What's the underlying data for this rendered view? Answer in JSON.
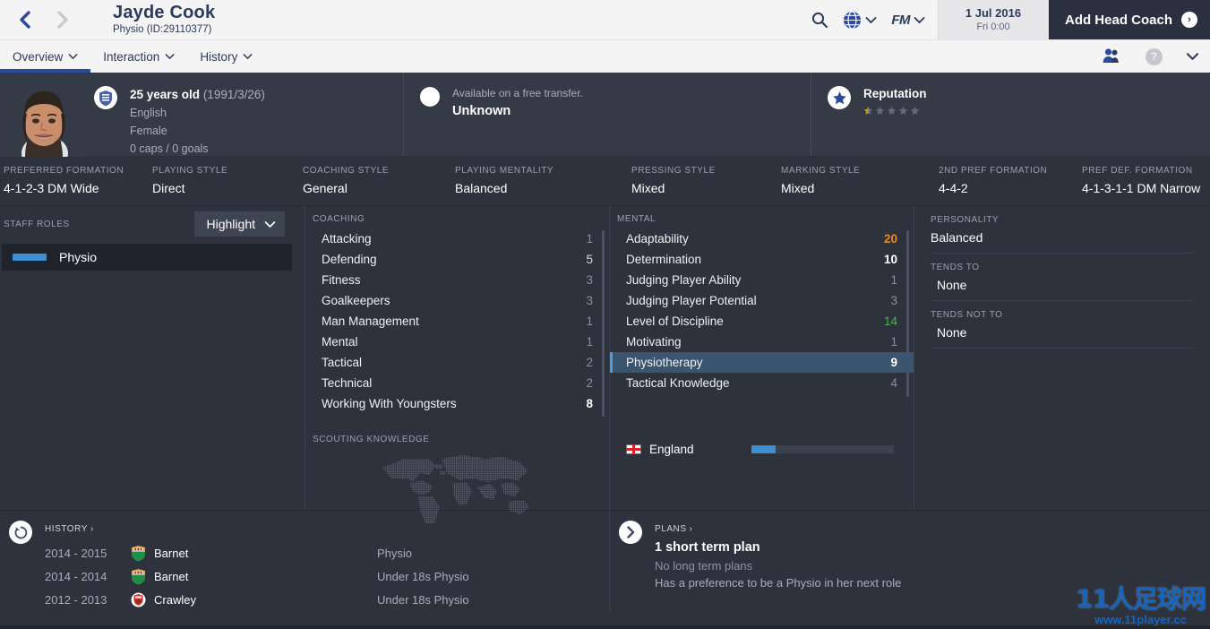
{
  "topbar": {
    "back_icon": "chevron-left-icon",
    "forward_icon": "chevron-right-icon",
    "person_name": "Jayde Cook",
    "person_subtitle": "Physio (ID:29110377)",
    "search_icon": "search-icon",
    "globe_icon": "globe-icon",
    "fm_logo": "FM",
    "date_main": "1 Jul 2016",
    "date_sub": "Fri 0:00",
    "add_coach_label": "Add Head Coach",
    "accent_blue": "#2c4a9c",
    "dark_panel": "#2b3040"
  },
  "subnav": {
    "items": [
      {
        "label": "Overview",
        "active": true
      },
      {
        "label": "Interaction",
        "active": false
      },
      {
        "label": "History",
        "active": false
      }
    ],
    "staff_icon": "people-icon",
    "help_label": "?",
    "more_icon": "chevron-down-icon"
  },
  "profile": {
    "photo_alt": "staff-portrait",
    "club_badge_icon": "club-badge-icon",
    "age_line_bold": "25 years old",
    "age_line_dim": "(1991/3/26)",
    "nationality": "English",
    "gender": "Female",
    "caps_goals": "0 caps / 0 goals",
    "transfer_status_label": "Available on a free transfer.",
    "transfer_value": "Unknown",
    "reputation_label": "Reputation",
    "reputation_stars": 0.5,
    "reputation_star_total": 5,
    "star_gold": "#c9a227",
    "star_grey": "#636a78"
  },
  "attributes_bar": [
    {
      "label": "PREFERRED FORMATION",
      "value": "4-1-2-3 DM Wide"
    },
    {
      "label": "PLAYING STYLE",
      "value": "Direct"
    },
    {
      "label": "COACHING STYLE",
      "value": "General"
    },
    {
      "label": "PLAYING MENTALITY",
      "value": "Balanced"
    },
    {
      "label": "PRESSING STYLE",
      "value": "Mixed"
    },
    {
      "label": "MARKING STYLE",
      "value": "Mixed"
    },
    {
      "label": "2ND PREF FORMATION",
      "value": "4-4-2"
    },
    {
      "label": "PREF DEF. FORMATION",
      "value": "4-1-3-1-1 DM Narrow"
    }
  ],
  "staff_roles": {
    "header": "STAFF ROLES",
    "dropdown_label": "Highlight",
    "dropdown_icon": "chevron-down-icon",
    "rows": [
      {
        "role": "Physio",
        "bar_color": "#3d8fd4"
      }
    ]
  },
  "coaching": {
    "header": "COACHING",
    "rows": [
      {
        "name": "Attacking",
        "value": "1",
        "tone": "low"
      },
      {
        "name": "Defending",
        "value": "5",
        "tone": "mid"
      },
      {
        "name": "Fitness",
        "value": "3",
        "tone": "low"
      },
      {
        "name": "Goalkeepers",
        "value": "3",
        "tone": "low"
      },
      {
        "name": "Man Management",
        "value": "1",
        "tone": "low"
      },
      {
        "name": "Mental",
        "value": "1",
        "tone": "low"
      },
      {
        "name": "Tactical",
        "value": "2",
        "tone": "low"
      },
      {
        "name": "Technical",
        "value": "2",
        "tone": "low"
      },
      {
        "name": "Working With Youngsters",
        "value": "8",
        "tone": "good"
      }
    ]
  },
  "mental": {
    "header": "MENTAL",
    "rows": [
      {
        "name": "Adaptability",
        "value": "20",
        "tone": "gold",
        "highlighted": false
      },
      {
        "name": "Determination",
        "value": "10",
        "tone": "good",
        "highlighted": false
      },
      {
        "name": "Judging Player Ability",
        "value": "1",
        "tone": "low",
        "highlighted": false
      },
      {
        "name": "Judging Player Potential",
        "value": "3",
        "tone": "low",
        "highlighted": false
      },
      {
        "name": "Level of Discipline",
        "value": "14",
        "tone": "green",
        "highlighted": false
      },
      {
        "name": "Motivating",
        "value": "1",
        "tone": "low",
        "highlighted": false
      },
      {
        "name": "Physiotherapy",
        "value": "9",
        "tone": "good",
        "highlighted": true
      },
      {
        "name": "Tactical Knowledge",
        "value": "4",
        "tone": "low",
        "highlighted": false
      }
    ]
  },
  "scouting": {
    "header": "SCOUTING KNOWLEDGE",
    "map_icon": "world-map-dotted"
  },
  "knowledge": {
    "country": "England",
    "flag_icon": "england-flag-icon",
    "percent": 17
  },
  "personality": {
    "personality_label": "PERSONALITY",
    "personality_value": "Balanced",
    "tends_to_label": "TENDS TO",
    "tends_to_value": "None",
    "tends_not_to_label": "TENDS NOT TO",
    "tends_not_to_value": "None"
  },
  "history": {
    "icon": "history-clock-icon",
    "header": "HISTORY",
    "header_chevron": "›",
    "rows": [
      {
        "years": "2014 - 2015",
        "club": "Barnet",
        "role": "Physio",
        "badge": "barnet-badge-icon"
      },
      {
        "years": "2014 - 2014",
        "club": "Barnet",
        "role": "Under 18s Physio",
        "badge": "barnet-badge-icon"
      },
      {
        "years": "2012 - 2013",
        "club": "Crawley",
        "role": "Under 18s Physio",
        "badge": "crawley-badge-icon"
      }
    ]
  },
  "plans": {
    "icon": "chevron-right-circle-icon",
    "header": "PLANS",
    "header_chevron": "›",
    "short_term": "1 short term plan",
    "long_term": "No long term plans",
    "preference": "Has a preference to be a Physio in her next role"
  },
  "watermark": {
    "cn_text": "11人足球网",
    "url_text": "www.11player.cc",
    "color": "#1565c0"
  }
}
